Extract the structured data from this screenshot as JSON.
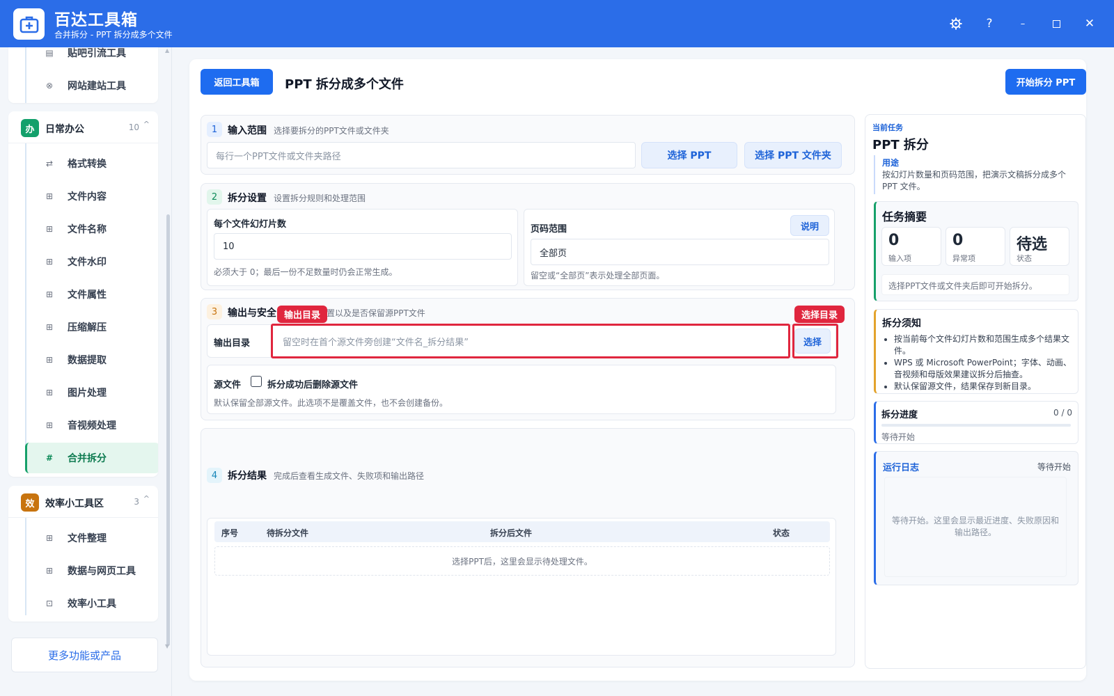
{
  "app": {
    "title": "百达工具箱",
    "subtitle": "合并拆分 - PPT 拆分成多个文件"
  },
  "window_controls": [
    "settings",
    "help",
    "minimize",
    "maximize",
    "close"
  ],
  "sidebar": {
    "partial_items": [
      {
        "label": "贴吧引流工具",
        "icon": "doc-icon"
      },
      {
        "label": "网站建站工具",
        "icon": "globe-icon"
      }
    ],
    "groups": [
      {
        "badge": "办",
        "title": "日常办公",
        "count": "10",
        "badge_color": "#13a06b",
        "items": [
          {
            "label": "格式转换",
            "icon": "swap-icon"
          },
          {
            "label": "文件内容",
            "icon": "grid-icon"
          },
          {
            "label": "文件名称",
            "icon": "grid-icon"
          },
          {
            "label": "文件水印",
            "icon": "grid-icon"
          },
          {
            "label": "文件属性",
            "icon": "grid-icon"
          },
          {
            "label": "压缩解压",
            "icon": "grid-icon"
          },
          {
            "label": "数据提取",
            "icon": "grid-icon"
          },
          {
            "label": "图片处理",
            "icon": "grid-icon"
          },
          {
            "label": "音视频处理",
            "icon": "grid-icon"
          },
          {
            "label": "合并拆分",
            "icon": "hash-icon",
            "active": true
          }
        ]
      },
      {
        "badge": "效",
        "title": "效率小工具区",
        "count": "3",
        "badge_color": "#c8740f",
        "items": [
          {
            "label": "文件整理",
            "icon": "grid-icon"
          },
          {
            "label": "数据与网页工具",
            "icon": "grid-icon"
          },
          {
            "label": "效率小工具",
            "icon": "toolbox-icon"
          }
        ]
      }
    ],
    "more_label": "更多功能或产品"
  },
  "main": {
    "back_label": "返回工具箱",
    "title": "PPT 拆分成多个文件",
    "start_label": "开始拆分 PPT",
    "s1": {
      "num": "1",
      "title": "输入范围",
      "desc": "选择要拆分的PPT文件或文件夹",
      "placeholder": "每行一个PPT文件或文件夹路径",
      "btn_file": "选择 PPT",
      "btn_folder": "选择 PPT 文件夹"
    },
    "s2": {
      "num": "2",
      "title": "拆分设置",
      "desc": "设置拆分规则和处理范围",
      "per_file_label": "每个文件幻灯片数",
      "per_file_value": "10",
      "per_file_hint": "必须大于 0；最后一份不足数量时仍会正常生成。",
      "range_label": "页码范围",
      "range_help": "说明",
      "range_value": "全部页",
      "range_hint": "留空或“全部页”表示处理全部页面。"
    },
    "s3": {
      "num": "3",
      "title": "输出与安全",
      "desc": "置以及是否保留源PPT文件",
      "output_label": "输出目录",
      "output_placeholder": "留空时在首个源文件旁创建“文件名_拆分结果”",
      "output_btn": "选择",
      "tag_output": "输出目录",
      "tag_select": "选择目录",
      "source_label": "源文件",
      "delete_label": "拆分成功后删除源文件",
      "delete_checked": false,
      "source_hint": "默认保留全部源文件。此选项不是覆盖文件，也不会创建备份。"
    },
    "s4": {
      "num": "4",
      "title": "拆分结果",
      "desc": "完成后查看生成文件、失败项和输出路径",
      "columns": [
        "序号",
        "待拆分文件",
        "拆分后文件",
        "状态"
      ],
      "empty_text": "选择PPT后，这里会显示待处理文件。"
    }
  },
  "right": {
    "eyebrow": "当前任务",
    "task_title": "PPT 拆分",
    "usage_label": "用途",
    "usage_text": "按幻灯片数量和页码范围，把演示文稿拆分成多个 PPT 文件。",
    "summary": {
      "title": "任务摘要",
      "stats": [
        {
          "value": "0",
          "label": "输入项"
        },
        {
          "value": "0",
          "label": "异常项"
        },
        {
          "value": "待选",
          "label": "状态"
        }
      ],
      "hint": "选择PPT文件或文件夹后即可开始拆分。"
    },
    "notice": {
      "title": "拆分须知",
      "items": [
        "按当前每个文件幻灯片数和范围生成多个结果文件。",
        "WPS 或 Microsoft PowerPoint；字体、动画、音视频和母版效果建议拆分后抽查。",
        "默认保留源文件，结果保存到新目录。"
      ]
    },
    "progress": {
      "title": "拆分进度",
      "count": "0 / 0",
      "fraction": 0,
      "status": "等待开始"
    },
    "log": {
      "title": "运行日志",
      "status": "等待开始",
      "placeholder": "等待开始。这里会显示最近进度、失败原因和输出路径。"
    }
  },
  "colors": {
    "brand": "#2b6de8",
    "primary_button": "#1e6cf0",
    "active_green": "#16a06a",
    "highlight_red": "#e0263e"
  }
}
